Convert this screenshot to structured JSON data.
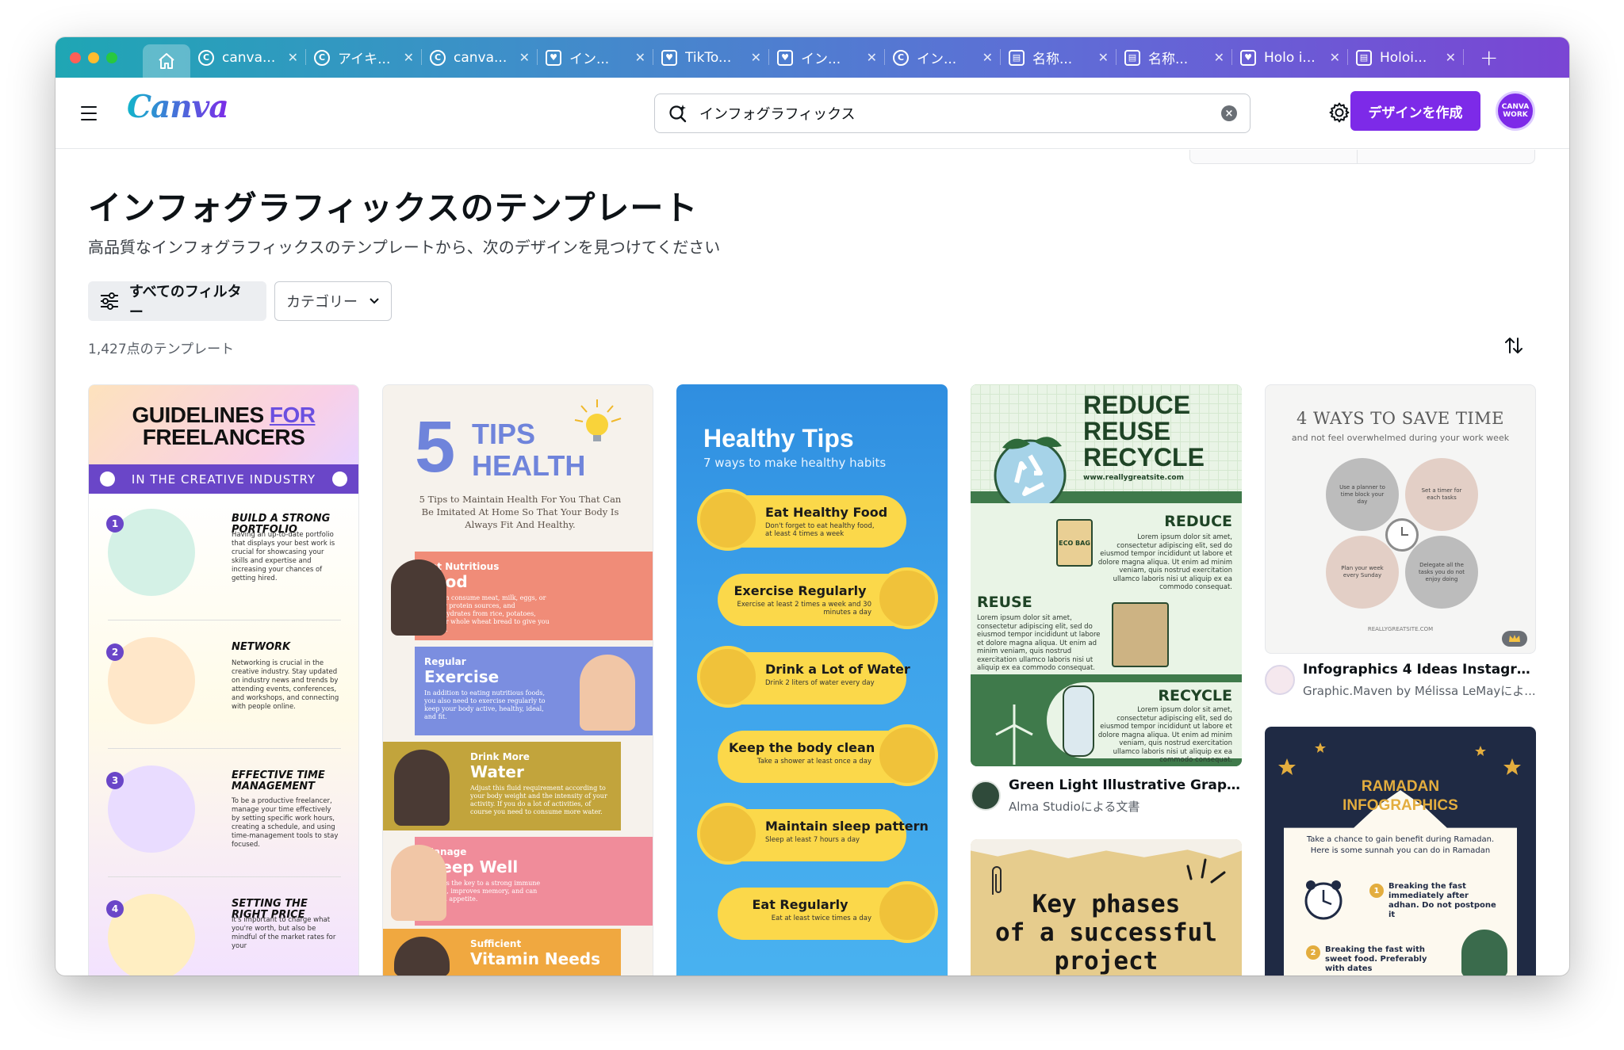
{
  "browser": {
    "home_tab": "home",
    "tabs": [
      {
        "icon": "canva-icon",
        "label": "canva..."
      },
      {
        "icon": "canva-icon",
        "label": "アイキ..."
      },
      {
        "icon": "canva-icon",
        "label": "canva..."
      },
      {
        "icon": "heart-icon",
        "label": "イン..."
      },
      {
        "icon": "heart-icon",
        "label": "TikTo..."
      },
      {
        "icon": "heart-icon",
        "label": "イン..."
      },
      {
        "icon": "canva-icon",
        "label": "イン..."
      },
      {
        "icon": "printer-icon",
        "label": "名称..."
      },
      {
        "icon": "printer-icon",
        "label": "名称..."
      },
      {
        "icon": "heart-icon",
        "label": "Holo i..."
      },
      {
        "icon": "printer-icon",
        "label": "Holoi..."
      }
    ],
    "new_tab": "+"
  },
  "header": {
    "logo": "Canva",
    "search_value": "インフォグラフィックス",
    "create_button": "デザインを作成",
    "avatar_text": "CANVA WORK"
  },
  "page": {
    "title": "インフォグラフィックスのテンプレート",
    "subtitle": "高品質なインフォグラフィックスのテンプレートから、次のデザインを見つけてください",
    "all_filters": "すべてのフィルター",
    "category": "カテゴリー",
    "count": "1,427点のテンプレート"
  },
  "templates": {
    "freelancers": {
      "title_line1": "GUIDELINES",
      "title_for": "FOR",
      "title_line2": "FREELANCERS",
      "banner": "IN THE CREATIVE INDUSTRY",
      "items": [
        {
          "n": "1",
          "h": "BUILD A STRONG PORTFOLIO",
          "b": "Having an up-to-date portfolio that displays your best work is crucial for showcasing your skills and expertise and increasing your chances of getting hired."
        },
        {
          "n": "2",
          "h": "NETWORK",
          "b": "Networking is crucial in the creative industry. Stay updated on industry news and trends by attending events, conferences, and workshops, and connecting with people online."
        },
        {
          "n": "3",
          "h": "EFFECTIVE TIME MANAGEMENT",
          "b": "To be a productive freelancer, manage your time effectively by setting specific work hours, creating a schedule, and using time-management tools to stay focused."
        },
        {
          "n": "4",
          "h": "SETTING THE RIGHT PRICE",
          "b": "It's important to charge what you're worth, but also be mindful of the market rates for your"
        }
      ]
    },
    "health": {
      "big5": "5",
      "tips": "TIPS",
      "health": "HEALTH",
      "intro": "5 Tips to Maintain Health For You That Can Be Imitated At Home So That Your Body Is Always Fit And Healthy.",
      "items": [
        {
          "small": "Eat Nutritious",
          "big": "Food",
          "body": "You can consume meat, milk, eggs, or fish for protein sources, and carbohydrates from rice, potatoes, oats, or whole wheat bread to give you energy."
        },
        {
          "small": "Regular",
          "big": "Exercise",
          "body": "In addition to eating nutritious foods, you also need to exercise regularly to keep your body active, healthy, ideal, and fit."
        },
        {
          "small": "Drink More",
          "big": "Water",
          "body": "Adjust this fluid requirement according to your body weight and the intensity of your activity. If you do a lot of activities, of course you need to consume more water."
        },
        {
          "small": "Manage",
          "big": "Sleep Well",
          "body": "Sleep is the key to a strong immune system, improves memory, and can control appetite."
        },
        {
          "small": "Sufficient",
          "big": "Vitamin Needs",
          "body": ""
        }
      ]
    },
    "healthy_tips": {
      "title": "Healthy Tips",
      "subtitle": "7 ways to make healthy habits",
      "items": [
        {
          "h": "Eat Healthy Food",
          "b": "Don't forget to eat healthy food, at least 4 times a week"
        },
        {
          "h": "Exercise Regularly",
          "b": "Exercise at least 2 times a week and 30 minutes a day"
        },
        {
          "h": "Drink a Lot of Water",
          "b": "Drink 2 liters of water every day"
        },
        {
          "h": "Keep the body clean",
          "b": "Take a shower at least once a day"
        },
        {
          "h": "Maintain sleep pattern",
          "b": "Sleep at least 7 hours a day"
        },
        {
          "h": "Eat Regularly",
          "b": "Eat at least twice times a day"
        }
      ]
    },
    "reduce": {
      "l1": "REDUCE",
      "l2": "REUSE",
      "l3": "RECYCLE",
      "site": "www.reallygreatsite.com",
      "s1": "REDUCE",
      "s2": "REUSE",
      "s3": "RECYCLE",
      "lorem": "Lorem ipsum dolor sit amet, consectetur adipiscing elit, sed do eiusmod tempor incididunt ut labore et dolore magna aliqua. Ut enim ad minim veniam, quis nostrud exercitation ullamco laboris nisi ut aliquip ex ea commodo consequat.",
      "bag": "ECO BAG",
      "meta_title": "Green Light Illustrative Graphic ...",
      "meta_author": "Alma Studioによる文書"
    },
    "key_phases": {
      "l1": "Key phases",
      "l2": "of a successful",
      "l3": "project"
    },
    "save_time": {
      "title": "4 WAYS TO SAVE TIME",
      "subtitle": "and not feel overwhelmed during your work week",
      "petals": [
        "Use a planner to time block your day",
        "Set a timer for each tasks",
        "Plan your week every Sunday",
        "Delegate all the tasks you do not enjoy doing"
      ],
      "site": "REALLYGREATSITE.COM",
      "meta_title": "Infographics 4 Ideas Instagram ...",
      "meta_author": "Graphic.Maven by Mélissa LeMayによ..."
    },
    "ramadan": {
      "l1": "RAMADAN",
      "l2": "INFOGRAPHICS",
      "intro": "Take a chance to gain benefit during Ramadan. Here is some sunnah you can do in Ramadan",
      "i1": "Breaking the fast immediately after adhan. Do not postpone it",
      "i2": "Breaking the fast with sweet food. Preferably with dates"
    }
  },
  "help_button": "?",
  "colors": {
    "accent": "#7d2ae8",
    "teal": "#12b5cb"
  }
}
